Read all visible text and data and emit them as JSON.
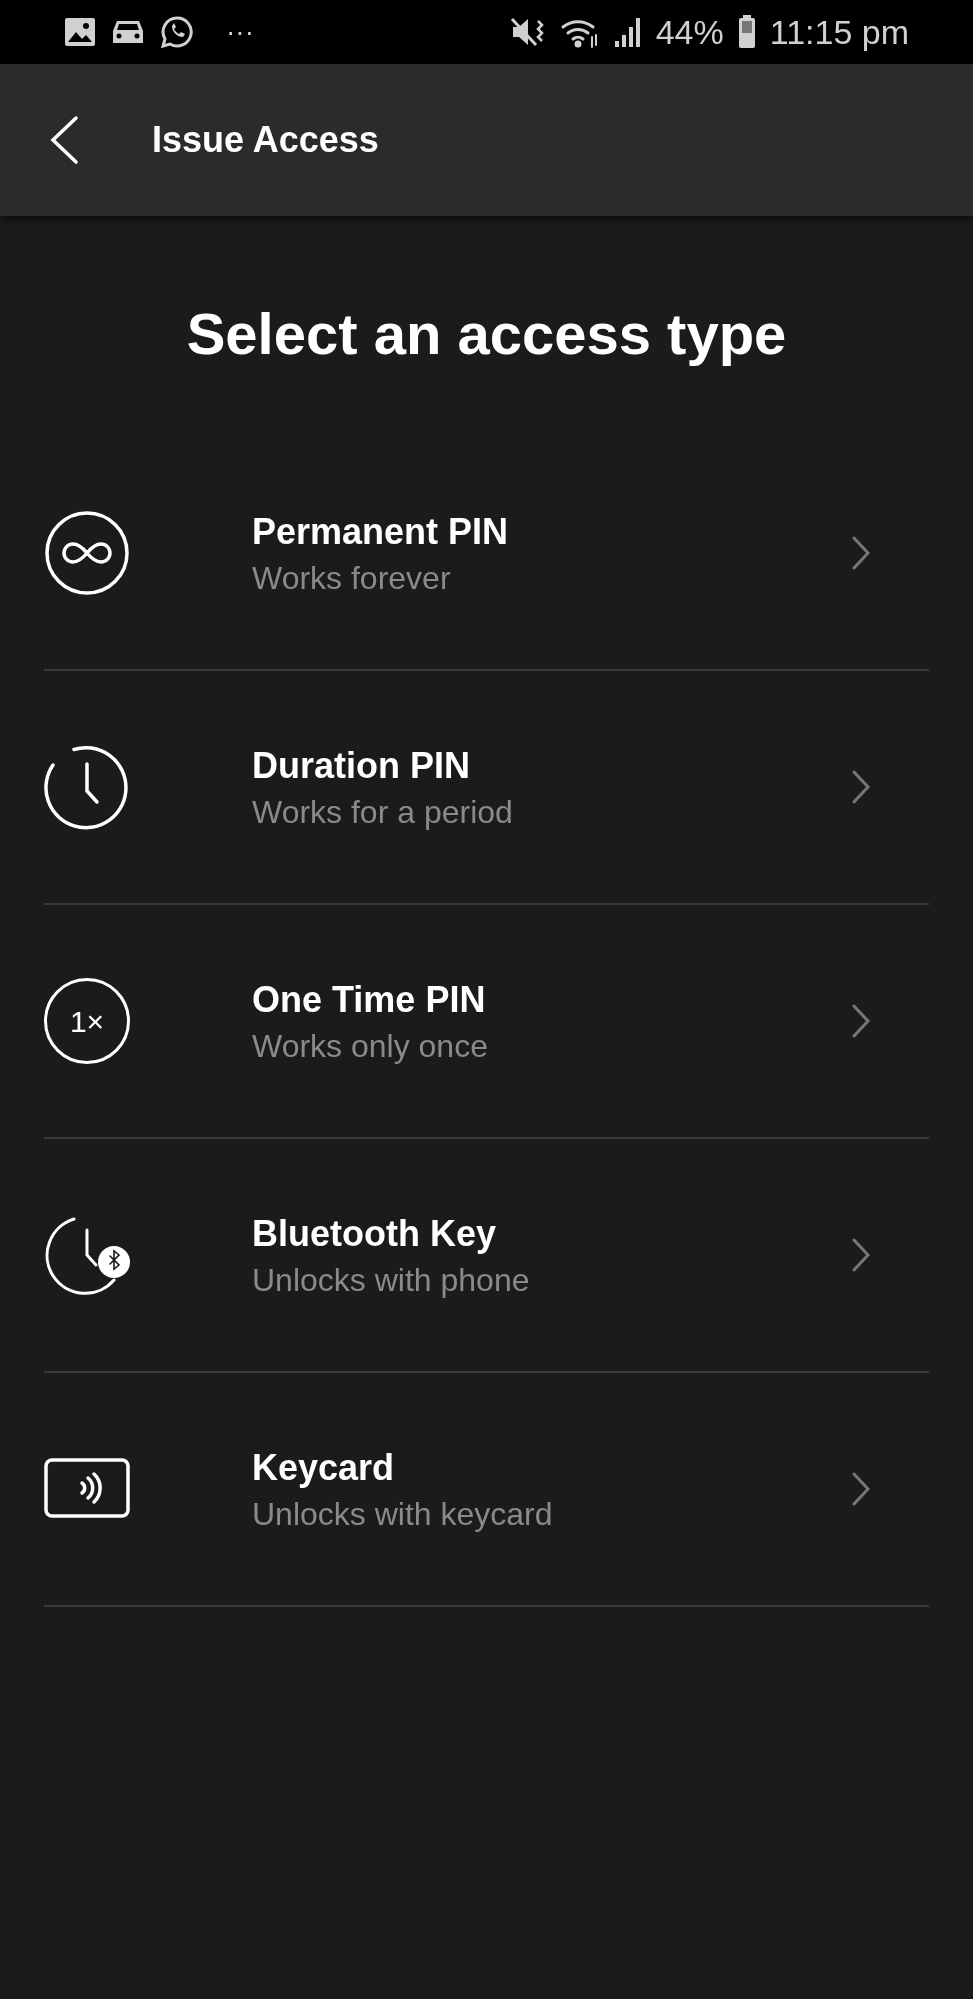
{
  "status_bar": {
    "more": "···",
    "battery_percent": "44%",
    "time": "11:15 pm"
  },
  "header": {
    "title": "Issue Access"
  },
  "heading": "Select an access type",
  "options": [
    {
      "kind": "infinity",
      "title": "Permanent PIN",
      "subtitle": "Works forever"
    },
    {
      "kind": "clock",
      "title": "Duration PIN",
      "subtitle": "Works for a period"
    },
    {
      "kind": "once",
      "icon_text": "1×",
      "title": "One Time PIN",
      "subtitle": "Works only once"
    },
    {
      "kind": "bluetooth",
      "title": "Bluetooth Key",
      "subtitle": "Unlocks with phone"
    },
    {
      "kind": "keycard",
      "title": "Keycard",
      "subtitle": "Unlocks with keycard"
    }
  ]
}
